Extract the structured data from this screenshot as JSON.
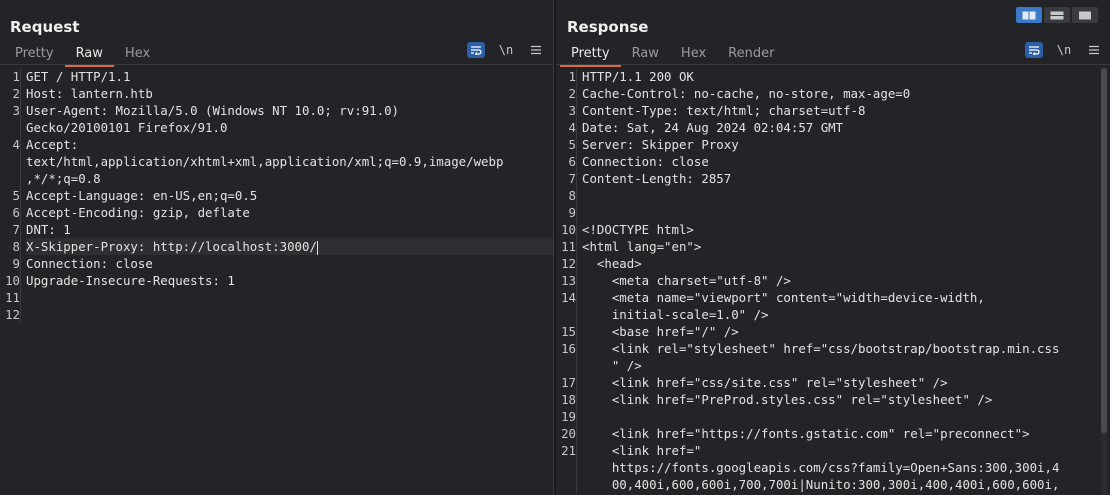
{
  "request": {
    "title": "Request",
    "tabs": [
      "Pretty",
      "Raw",
      "Hex"
    ],
    "active_tab": "Raw",
    "lines": [
      {
        "n": "1",
        "text": "GET / HTTP/1.1"
      },
      {
        "n": "2",
        "text": "Host: lantern.htb"
      },
      {
        "n": "3",
        "text": "User-Agent: Mozilla/5.0 (Windows NT 10.0; rv:91.0)"
      },
      {
        "n": "",
        "text": "Gecko/20100101 Firefox/91.0"
      },
      {
        "n": "4",
        "text": "Accept:"
      },
      {
        "n": "",
        "text": "text/html,application/xhtml+xml,application/xml;q=0.9,image/webp"
      },
      {
        "n": "",
        "text": ",*/*;q=0.8"
      },
      {
        "n": "5",
        "text": "Accept-Language: en-US,en;q=0.5"
      },
      {
        "n": "6",
        "text": "Accept-Encoding: gzip, deflate"
      },
      {
        "n": "7",
        "text": "DNT: 1"
      },
      {
        "n": "8",
        "text": "X-Skipper-Proxy: http://localhost:3000/"
      },
      {
        "n": "9",
        "text": "Connection: close"
      },
      {
        "n": "10",
        "text": "Upgrade-Insecure-Requests: 1"
      },
      {
        "n": "11",
        "text": ""
      },
      {
        "n": "12",
        "text": ""
      }
    ]
  },
  "response": {
    "title": "Response",
    "tabs": [
      "Pretty",
      "Raw",
      "Hex",
      "Render"
    ],
    "active_tab": "Pretty",
    "lines": [
      {
        "n": "1",
        "text": "HTTP/1.1 200 OK"
      },
      {
        "n": "2",
        "text": "Cache-Control: no-cache, no-store, max-age=0"
      },
      {
        "n": "3",
        "text": "Content-Type: text/html; charset=utf-8"
      },
      {
        "n": "4",
        "text": "Date: Sat, 24 Aug 2024 02:04:57 GMT"
      },
      {
        "n": "5",
        "text": "Server: Skipper Proxy"
      },
      {
        "n": "6",
        "text": "Connection: close"
      },
      {
        "n": "7",
        "text": "Content-Length: 2857"
      },
      {
        "n": "8",
        "text": ""
      },
      {
        "n": "9",
        "text": ""
      },
      {
        "n": "10",
        "text": "<!DOCTYPE html>"
      },
      {
        "n": "11",
        "text": "<html lang=\"en\">"
      },
      {
        "n": "12",
        "text": "  <head>"
      },
      {
        "n": "13",
        "text": "    <meta charset=\"utf-8\" />"
      },
      {
        "n": "14",
        "text": "    <meta name=\"viewport\" content=\"width=device-width,"
      },
      {
        "n": "",
        "text": "    initial-scale=1.0\" />"
      },
      {
        "n": "15",
        "text": "    <base href=\"/\" />"
      },
      {
        "n": "16",
        "text": "    <link rel=\"stylesheet\" href=\"css/bootstrap/bootstrap.min.css"
      },
      {
        "n": "",
        "text": "    \" />"
      },
      {
        "n": "17",
        "text": "    <link href=\"css/site.css\" rel=\"stylesheet\" />"
      },
      {
        "n": "18",
        "text": "    <link href=\"PreProd.styles.css\" rel=\"stylesheet\" />"
      },
      {
        "n": "19",
        "text": ""
      },
      {
        "n": "20",
        "text": "    <link href=\"https://fonts.gstatic.com\" rel=\"preconnect\">"
      },
      {
        "n": "21",
        "text": "    <link href=\""
      },
      {
        "n": "",
        "text": "    https://fonts.googleapis.com/css?family=Open+Sans:300,300i,4"
      },
      {
        "n": "",
        "text": "    00,400i,600,600i,700,700i|Nunito:300,300i,400,400i,600,600i,"
      }
    ]
  },
  "toolbar": {
    "wrap_icon": "word-wrap-icon",
    "newline_label": "\\n",
    "menu_icon": "hamburger-menu-icon"
  },
  "layout_toggle": [
    "side-by-side-icon",
    "stacked-icon",
    "single-pane-icon"
  ],
  "colors": {
    "accent": "#e06a3c",
    "active_blue": "#3b78c6",
    "string_yellow": "#d6c768",
    "background": "#232428"
  }
}
